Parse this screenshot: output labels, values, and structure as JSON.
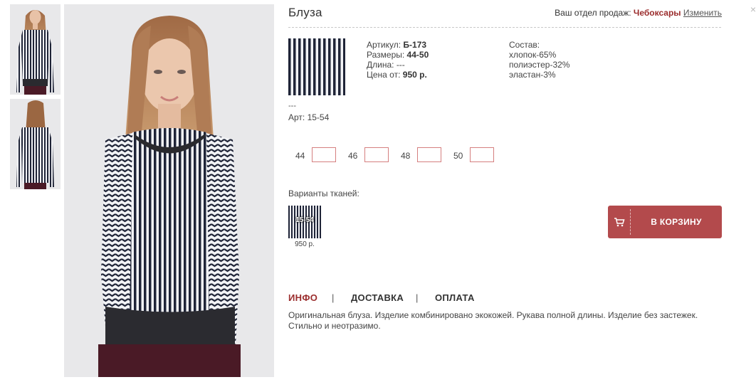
{
  "product": {
    "title": "Блуза",
    "article_label": "Артикул:",
    "article_value": "Б-173",
    "sizes_label": "Размеры:",
    "sizes_value": "44-50",
    "length_label": "Длина:",
    "length_value": "---",
    "price_label": "Цена от:",
    "price_value": "950 р.",
    "composition_label": "Состав:",
    "composition": [
      "хлопок-65%",
      "полиэстер-32%",
      "эластан-3%"
    ],
    "fabric_dash": "---",
    "fabric_code": "Арт: 15-54"
  },
  "region": {
    "label": "Ваш отдел продаж:",
    "city": "Чебоксары",
    "change": "Изменить"
  },
  "sizes": [
    {
      "label": "44",
      "value": ""
    },
    {
      "label": "46",
      "value": ""
    },
    {
      "label": "48",
      "value": ""
    },
    {
      "label": "50",
      "value": ""
    }
  ],
  "variants": {
    "label": "Варианты тканей:",
    "items": [
      {
        "code": "15-54",
        "price": "950 р."
      }
    ]
  },
  "cart": {
    "label": "В КОРЗИНУ"
  },
  "tabs": [
    {
      "label": "ИНФО",
      "active": true
    },
    {
      "label": "ДОСТАВКА",
      "active": false
    },
    {
      "label": "ОПЛАТА",
      "active": false
    }
  ],
  "tab_separator": "|",
  "description": "Оригинальная блуза. Изделие комбинировано экокожей. Рукава полной длины. Изделие без застежек. Стильно и неотразимо.",
  "close_glyph": "×",
  "colors": {
    "accent": "#9b2d2d",
    "button": "#b34a4c",
    "size_border": "#d57f7f"
  },
  "icons": {
    "cart": "cart-icon",
    "close": "close-icon"
  }
}
